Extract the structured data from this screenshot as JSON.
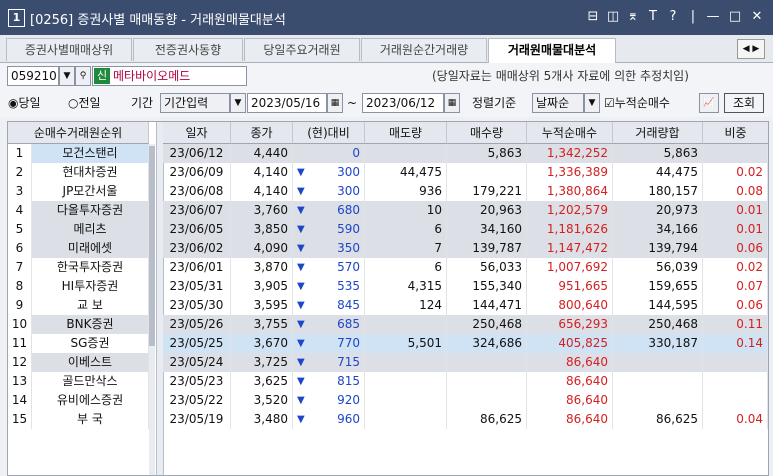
{
  "window": {
    "number": "1",
    "title": "[0256] 증권사별 매매동향 - 거래원매물대분석",
    "controls": [
      "⊟",
      "◫",
      "⌆",
      "T",
      "?",
      "|",
      "—",
      "□",
      "✕"
    ]
  },
  "tabs": [
    "증권사별매매상위",
    "전증권사동향",
    "당일주요거래원",
    "거래원순간거래량",
    "거래원매물대분석"
  ],
  "active_tab": 4,
  "toolbar": {
    "code": "059210",
    "stock_badge": "신",
    "stock_name": "메타바이오메드",
    "note": "(당일자료는 매매상위 5개사 자료에 의한 추정치임)",
    "radio_today": "당일",
    "radio_prev": "전일",
    "period_label": "기간",
    "period_mode": "기간입력",
    "date_from": "2023/05/16",
    "tilde": "~",
    "date_to": "2023/06/12",
    "sort_label": "정렬기준",
    "sort_value": "날짜순",
    "cumulative_label": "누적순매수",
    "query_button": "조회"
  },
  "left_table": {
    "header": "순매수거래원순위",
    "rows": [
      {
        "rank": "1",
        "name": "모건스탠리"
      },
      {
        "rank": "2",
        "name": "현대차증권"
      },
      {
        "rank": "3",
        "name": "JP모간서울"
      },
      {
        "rank": "4",
        "name": "다올투자증권"
      },
      {
        "rank": "5",
        "name": "메리츠"
      },
      {
        "rank": "6",
        "name": "미래에셋"
      },
      {
        "rank": "7",
        "name": "한국투자증권"
      },
      {
        "rank": "8",
        "name": "HI투자증권"
      },
      {
        "rank": "9",
        "name": "교 보"
      },
      {
        "rank": "10",
        "name": "BNK증권"
      },
      {
        "rank": "11",
        "name": "SG증권"
      },
      {
        "rank": "12",
        "name": "이베스트"
      },
      {
        "rank": "13",
        "name": "골드만삭스"
      },
      {
        "rank": "14",
        "name": "유비에스증권"
      },
      {
        "rank": "15",
        "name": "부 국"
      }
    ]
  },
  "main_table": {
    "headers": [
      "일자",
      "종가",
      "(현)대비",
      "매도량",
      "매수량",
      "누적순매수",
      "거래량합",
      "비중"
    ],
    "rows": [
      {
        "date": "23/06/12",
        "close": "4,440",
        "arrow": "",
        "change": "0",
        "sell": "",
        "buy": "5,863",
        "cum": "1,342,252",
        "vol": "5,863",
        "ratio": ""
      },
      {
        "date": "23/06/09",
        "close": "4,140",
        "arrow": "▼",
        "change": "300",
        "sell": "44,475",
        "buy": "",
        "cum": "1,336,389",
        "vol": "44,475",
        "ratio": "0.02"
      },
      {
        "date": "23/06/08",
        "close": "4,140",
        "arrow": "▼",
        "change": "300",
        "sell": "936",
        "buy": "179,221",
        "cum": "1,380,864",
        "vol": "180,157",
        "ratio": "0.08"
      },
      {
        "date": "23/06/07",
        "close": "3,760",
        "arrow": "▼",
        "change": "680",
        "sell": "10",
        "buy": "20,963",
        "cum": "1,202,579",
        "vol": "20,973",
        "ratio": "0.01"
      },
      {
        "date": "23/06/05",
        "close": "3,850",
        "arrow": "▼",
        "change": "590",
        "sell": "6",
        "buy": "34,160",
        "cum": "1,181,626",
        "vol": "34,166",
        "ratio": "0.01"
      },
      {
        "date": "23/06/02",
        "close": "4,090",
        "arrow": "▼",
        "change": "350",
        "sell": "7",
        "buy": "139,787",
        "cum": "1,147,472",
        "vol": "139,794",
        "ratio": "0.06"
      },
      {
        "date": "23/06/01",
        "close": "3,870",
        "arrow": "▼",
        "change": "570",
        "sell": "6",
        "buy": "56,033",
        "cum": "1,007,692",
        "vol": "56,039",
        "ratio": "0.02"
      },
      {
        "date": "23/05/31",
        "close": "3,905",
        "arrow": "▼",
        "change": "535",
        "sell": "4,315",
        "buy": "155,340",
        "cum": "951,665",
        "vol": "159,655",
        "ratio": "0.07"
      },
      {
        "date": "23/05/30",
        "close": "3,595",
        "arrow": "▼",
        "change": "845",
        "sell": "124",
        "buy": "144,471",
        "cum": "800,640",
        "vol": "144,595",
        "ratio": "0.06"
      },
      {
        "date": "23/05/26",
        "close": "3,755",
        "arrow": "▼",
        "change": "685",
        "sell": "",
        "buy": "250,468",
        "cum": "656,293",
        "vol": "250,468",
        "ratio": "0.11"
      },
      {
        "date": "23/05/25",
        "close": "3,670",
        "arrow": "▼",
        "change": "770",
        "sell": "5,501",
        "buy": "324,686",
        "cum": "405,825",
        "vol": "330,187",
        "ratio": "0.14"
      },
      {
        "date": "23/05/24",
        "close": "3,725",
        "arrow": "▼",
        "change": "715",
        "sell": "",
        "buy": "",
        "cum": "86,640",
        "vol": "",
        "ratio": ""
      },
      {
        "date": "23/05/23",
        "close": "3,625",
        "arrow": "▼",
        "change": "815",
        "sell": "",
        "buy": "",
        "cum": "86,640",
        "vol": "",
        "ratio": ""
      },
      {
        "date": "23/05/22",
        "close": "3,520",
        "arrow": "▼",
        "change": "920",
        "sell": "",
        "buy": "",
        "cum": "86,640",
        "vol": "",
        "ratio": ""
      },
      {
        "date": "23/05/19",
        "close": "3,480",
        "arrow": "▼",
        "change": "960",
        "sell": "",
        "buy": "86,625",
        "cum": "86,640",
        "vol": "86,625",
        "ratio": "0.04"
      }
    ]
  },
  "colors": {
    "title_bg": "#3b4d6e",
    "up_red": "#d42020",
    "down_blue": "#1c47c9",
    "row_highlight": "#dcdfe6",
    "row_selected": "#cfe3f5"
  }
}
